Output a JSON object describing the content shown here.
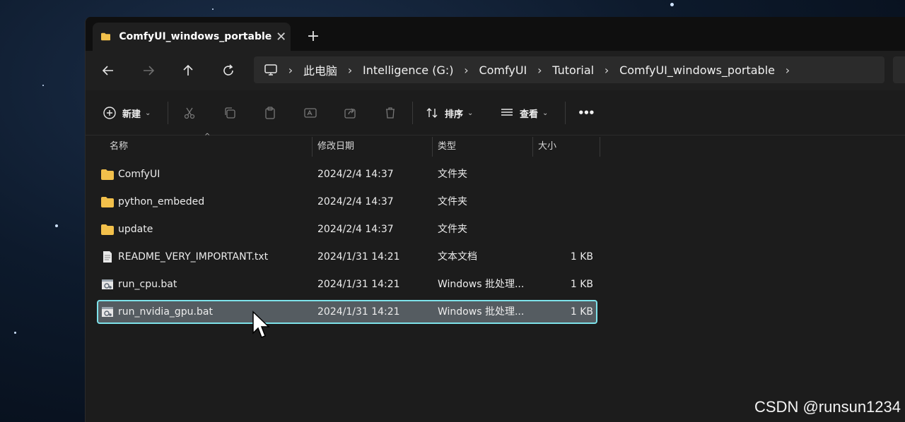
{
  "tab": {
    "title": "ComfyUI_windows_portable",
    "close_glyph": "✕",
    "new_glyph": "+"
  },
  "address": {
    "crumbs": [
      "此电脑",
      "Intelligence (G:)",
      "ComfyUI",
      "Tutorial",
      "ComfyUI_windows_portable"
    ],
    "separator": "›"
  },
  "toolbar": {
    "new_label": "新建",
    "sort_label": "排序",
    "view_label": "查看",
    "more_label": "•••",
    "caret": "⌄"
  },
  "columns": {
    "name": "名称",
    "date": "修改日期",
    "type": "类型",
    "size": "大小"
  },
  "files": [
    {
      "name": "ComfyUI",
      "date": "2024/2/4 14:37",
      "type": "文件夹",
      "size": "",
      "icon": "folder-icon"
    },
    {
      "name": "python_embeded",
      "date": "2024/2/4 14:37",
      "type": "文件夹",
      "size": "",
      "icon": "folder-icon"
    },
    {
      "name": "update",
      "date": "2024/2/4 14:37",
      "type": "文件夹",
      "size": "",
      "icon": "folder-icon"
    },
    {
      "name": "README_VERY_IMPORTANT.txt",
      "date": "2024/1/31 14:21",
      "type": "文本文档",
      "size": "1 KB",
      "icon": "text-file-icon"
    },
    {
      "name": "run_cpu.bat",
      "date": "2024/1/31 14:21",
      "type": "Windows 批处理...",
      "size": "1 KB",
      "icon": "batch-file-icon"
    },
    {
      "name": "run_nvidia_gpu.bat",
      "date": "2024/1/31 14:21",
      "type": "Windows 批处理...",
      "size": "1 KB",
      "icon": "batch-file-icon",
      "selected": true
    }
  ],
  "watermark": "CSDN @runsun1234",
  "colors": {
    "accent_selection": "#7ee2ea",
    "folder": "#f2c04b",
    "window_bg": "#1c1c1c"
  }
}
